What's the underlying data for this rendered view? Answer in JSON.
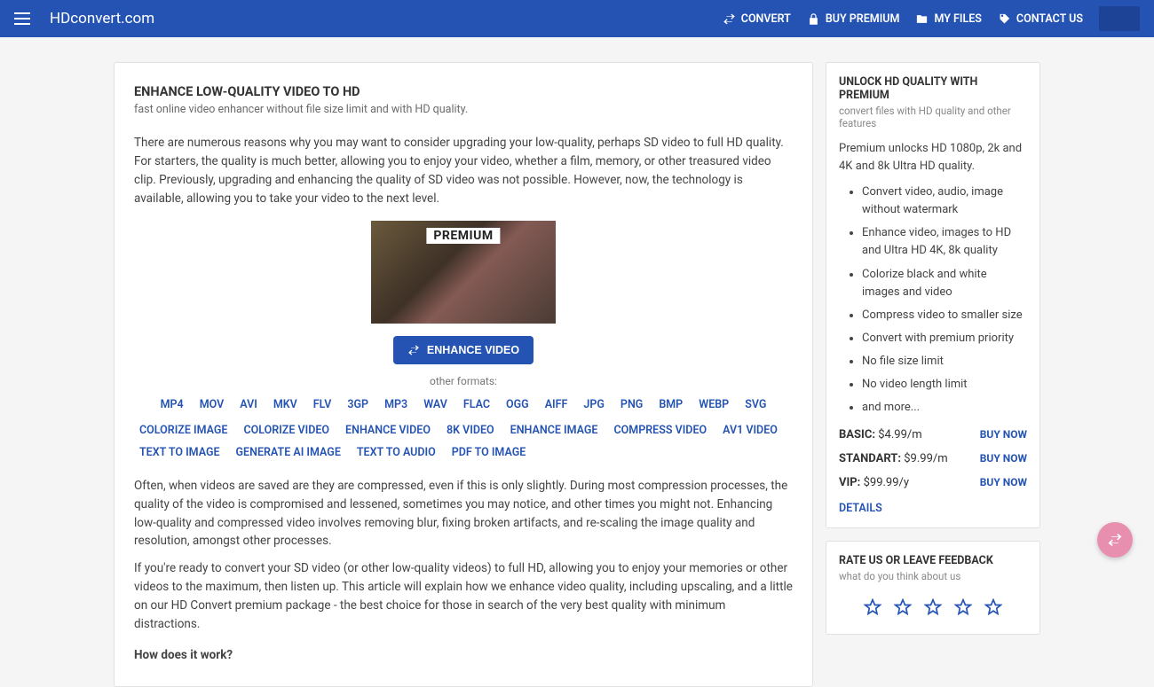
{
  "header": {
    "brand": "HDconvert.com",
    "nav": {
      "convert": "CONVERT",
      "buy_premium": "BUY PREMIUM",
      "my_files": "MY FILES",
      "contact": "CONTACT US"
    }
  },
  "main": {
    "title": "ENHANCE LOW-QUALITY VIDEO TO HD",
    "subtitle": "fast online video enhancer without file size limit and with HD quality.",
    "para1": "There are numerous reasons why you may want to consider upgrading your low-quality, perhaps SD video to full HD quality. For starters, the quality is much better, allowing you to enjoy your video, whether a film, memory, or other treasured video clip. Previously, upgrading and enhancing the quality of SD video was not possible. However, now, the technology is available, allowing you to take your video to the next level.",
    "premium_tag": "PREMIUM",
    "enhance_btn": "ENHANCE VIDEO",
    "other_formats_label": "other formats:",
    "formats": [
      "MP4",
      "MOV",
      "AVI",
      "MKV",
      "FLV",
      "3GP",
      "MP3",
      "WAV",
      "FLAC",
      "OGG",
      "AIFF",
      "JPG",
      "PNG",
      "BMP",
      "WEBP",
      "SVG"
    ],
    "tools": [
      "COLORIZE IMAGE",
      "COLORIZE VIDEO",
      "ENHANCE VIDEO",
      "8K VIDEO",
      "ENHANCE IMAGE",
      "COMPRESS VIDEO",
      "AV1 VIDEO",
      "TEXT TO IMAGE",
      "GENERATE AI IMAGE",
      "TEXT TO AUDIO",
      "PDF TO IMAGE"
    ],
    "para2": "Often, when videos are saved are they are compressed, even if this is only slightly. During most compression processes, the quality of the video is compromised and lessened, sometimes you may notice, and other times you might not. Enhancing low-quality and compressed video involves removing blur, fixing broken artifacts, and re-scaling the image quality and resolution, amongst other processes.",
    "para3": "If you're ready to convert your SD video (or other low-quality videos) to full HD, allowing you to enjoy your memories or other videos to the maximum, then listen up. This article will explain how we enhance video quality, including upscaling, and a little on our HD Convert premium package - the best choice for those in search of the very best quality with minimum distractions.",
    "howq": "How does it work?"
  },
  "premium": {
    "title": "UNLOCK HD QUALITY WITH PREMIUM",
    "subtitle": "convert files with HD quality and other features",
    "desc": "Premium unlocks HD 1080p, 2k and 4K and 8k Ultra HD quality.",
    "features": [
      "Convert video, audio, image without watermark",
      "Enhance video, images to HD and Ultra HD 4K, 8k quality",
      "Colorize black and white images and video",
      "Compress video to smaller size",
      "Convert with premium priority",
      "No file size limit",
      "No video length limit",
      "and more..."
    ],
    "plans": [
      {
        "name": "BASIC:",
        "price": "$4.99/m"
      },
      {
        "name": "STANDART:",
        "price": "$9.99/m"
      },
      {
        "name": "VIP:",
        "price": "$99.99/y"
      }
    ],
    "buy_now": "BUY NOW",
    "details": "DETAILS"
  },
  "feedback": {
    "title": "RATE US OR LEAVE FEEDBACK",
    "subtitle": "what do you think about us"
  }
}
